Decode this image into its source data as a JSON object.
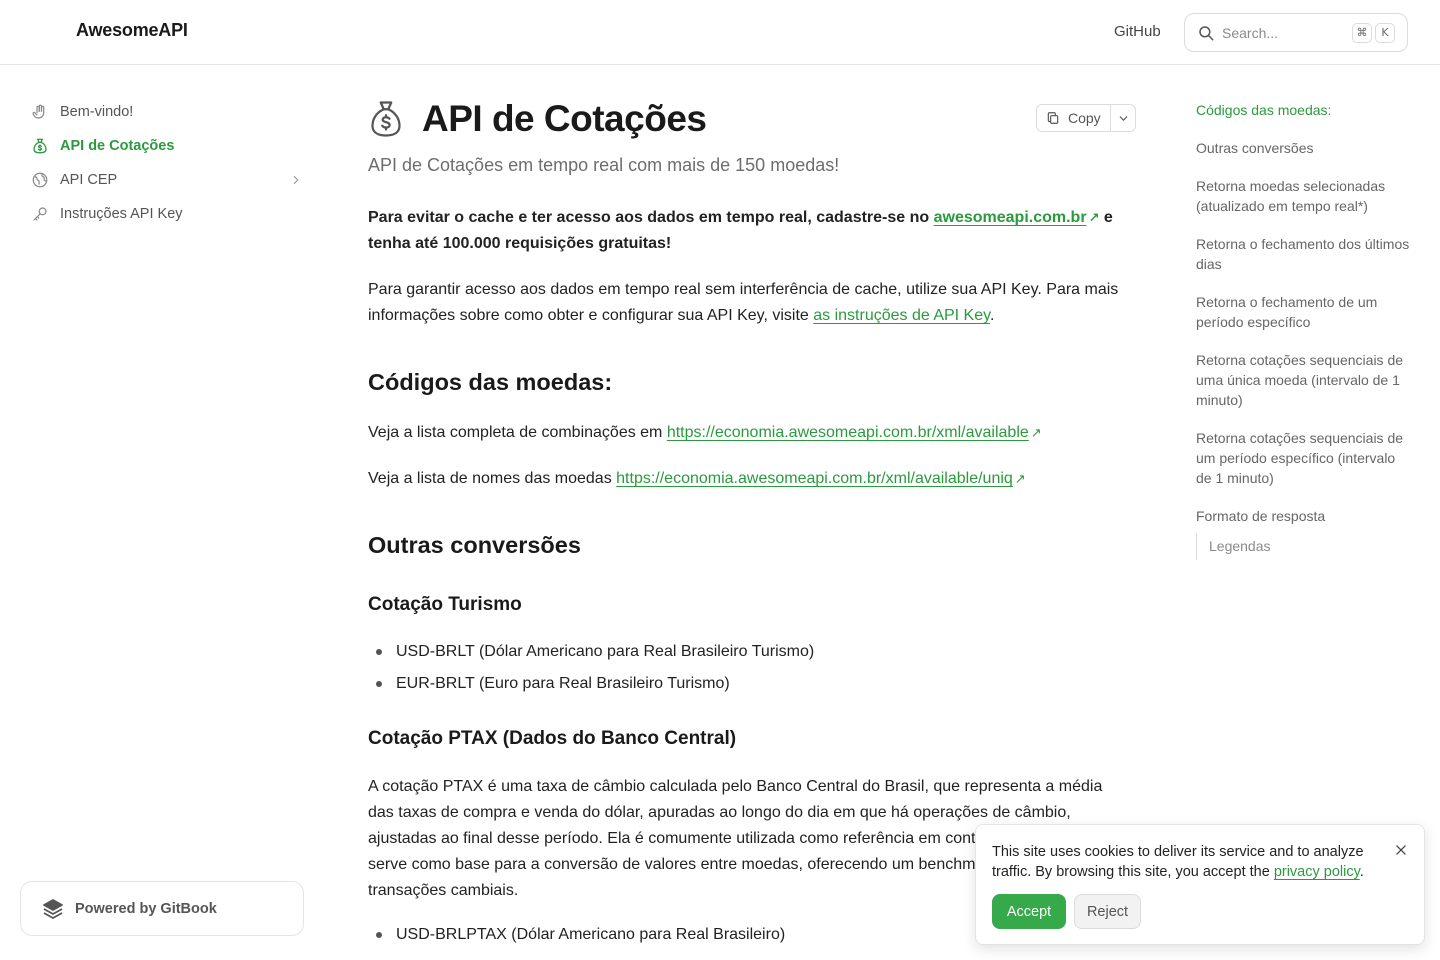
{
  "header": {
    "brand": "AwesomeAPI",
    "github_label": "GitHub",
    "search_placeholder": "Search...",
    "kbd_cmd": "⌘",
    "kbd_k": "K"
  },
  "sidebar": {
    "items": [
      {
        "label": "Bem-vindo!",
        "icon": "wave-hand-icon"
      },
      {
        "label": "API de Cotações",
        "icon": "money-bag-icon",
        "active": true
      },
      {
        "label": "API CEP",
        "icon": "globe-icon"
      },
      {
        "label": "Instruções API Key",
        "icon": "key-icon"
      }
    ],
    "powered_by": "Powered by GitBook"
  },
  "page": {
    "title": "API de Cotações",
    "copy_label": "Copy",
    "subtitle": "API de Cotações em tempo real com mais de 150 moedas!",
    "intro_bold_1": "Para evitar o cache e ter acesso aos dados em tempo real, cadastre-se no ",
    "intro_link": "awesomeapi.com.br",
    "intro_bold_2": " e tenha até 100.000 requisições gratuitas!",
    "apikey_text": "Para garantir acesso aos dados em tempo real sem interferência de cache, utilize sua API Key. Para mais informações sobre como obter e configurar sua API Key, visite ",
    "apikey_link": "as instruções de API Key",
    "apikey_end": ".",
    "h_codigos": "Códigos das moedas:",
    "lista_completa_text": "Veja a lista completa de combinações em ",
    "lista_completa_link": "https://economia.awesomeapi.com.br/xml/available",
    "lista_nomes_text": "Veja a lista de nomes das moedas ",
    "lista_nomes_link": "https://economia.awesomeapi.com.br/xml/available/uniq",
    "h_outras": "Outras conversões",
    "h_turismo": "Cotação Turismo",
    "turismo_items": [
      "USD-BRLT (Dólar Americano para Real Brasileiro Turismo)",
      "EUR-BRLT (Euro para Real Brasileiro Turismo)"
    ],
    "h_ptax": "Cotação PTAX (Dados do Banco Central)",
    "ptax_text": "A cotação PTAX é uma taxa de câmbio calculada pelo Banco Central do Brasil, que representa a média das taxas de compra e venda do dólar, apuradas ao longo do dia em que há operações de câmbio, ajustadas ao final desse período. Ela é comumente utilizada como referência em contratos financeiros e serve como base para a conversão de valores entre moedas, oferecendo um benchmark confiável para transações cambiais.",
    "ptax_items": [
      "USD-BRLPTAX (Dólar Americano para Real Brasileiro)"
    ]
  },
  "toc": {
    "items": [
      "Códigos das moedas:",
      "Outras conversões",
      "Retorna moedas selecionadas (atualizado em tempo real*)",
      "Retorna o fechamento dos últimos dias",
      "Retorna o fechamento de um período específico",
      "Retorna cotações sequenciais de uma única moeda (intervalo de 1 minuto)",
      "Retorna cotações sequenciais de um período específico (intervalo de 1 minuto)",
      "Formato de resposta"
    ],
    "sub_item": "Legendas"
  },
  "cookie": {
    "text": "This site uses cookies to deliver its service and to analyze traffic. By browsing this site, you accept the ",
    "link": "privacy policy",
    "end": ".",
    "accept": "Accept",
    "reject": "Reject"
  },
  "colors": {
    "accent": "#2b9a3e",
    "accept_button": "#36a94a"
  }
}
